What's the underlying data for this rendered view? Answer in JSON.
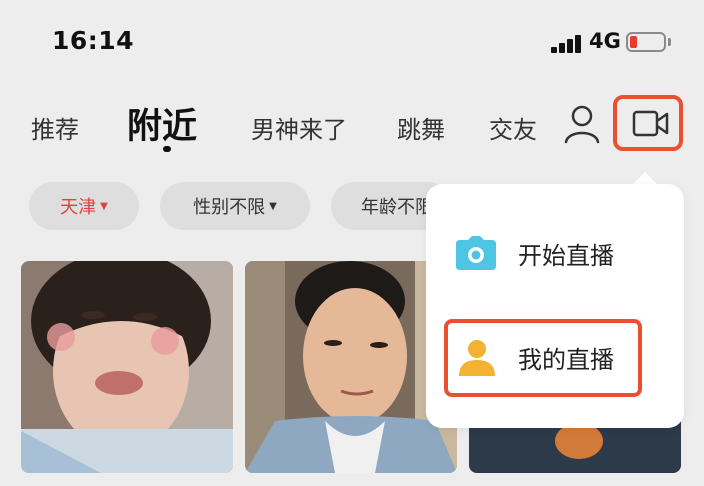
{
  "status_bar": {
    "time": "16:14",
    "network": "4G",
    "icons": [
      "signal-icon",
      "battery-icon"
    ],
    "battery_color": "#e63b2e"
  },
  "tabs": [
    {
      "label": "推荐",
      "active": false
    },
    {
      "label": "附近",
      "active": true
    },
    {
      "label": "男神来了",
      "active": false
    },
    {
      "label": "跳舞",
      "active": false
    },
    {
      "label": "交友",
      "active": false
    }
  ],
  "header_icons": [
    "user-icon",
    "video-camera-icon"
  ],
  "filters": {
    "city": "天津",
    "gender": "性别不限",
    "age": "年龄不限"
  },
  "dropdown": {
    "start_live": "开始直播",
    "my_live": "我的直播",
    "icons": [
      "camera-icon",
      "person-icon"
    ]
  },
  "colors": {
    "accent": "#e8502e",
    "city_text": "#e04040",
    "camera_icon": "#4cc6e2",
    "person_icon": "#f4b233"
  }
}
